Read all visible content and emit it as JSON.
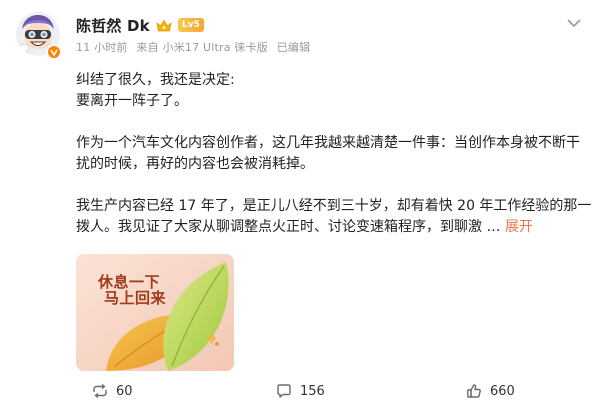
{
  "author": {
    "name": "陈哲然 Dk",
    "level_badge": "Lv5",
    "icons": {
      "avatar": "cartoon-avatar",
      "verified": "orange-vip-badge",
      "member": "crown-icon"
    },
    "brand_color": "#ff8200"
  },
  "meta": {
    "time": "11 小时前",
    "source": "来自 小米17 Ultra 徕卡版",
    "edited": "已编辑"
  },
  "more_icon": "chevron-down-icon",
  "post": {
    "paragraphs": [
      {
        "lines": [
          "纠结了很久，我还是决定:",
          "要离开一阵子了。"
        ]
      },
      {
        "lines": [
          "作为一个汽车文化内容创作者，这几年我越来越清楚一件事：当创作本身被不断干",
          "扰的时候，再好的内容也会被消耗掉。"
        ]
      },
      {
        "lines": [
          "我生产内容已经 17 年了，是正儿八经不到三十岁，却有着快 20 年工作经验的那一",
          "拨人。我见证了大家从聊调整点火正时、讨论变速箱程序，到聊激 …"
        ]
      }
    ],
    "expand_label": "展开",
    "link_color": "#eb7350"
  },
  "image": {
    "line1": "休息一下",
    "line2": "马上回来"
  },
  "actions": {
    "repost": {
      "icon": "repost-icon",
      "count": "60"
    },
    "comment": {
      "icon": "comment-icon",
      "count": "156"
    },
    "like": {
      "icon": "thumbs-up-icon",
      "count": "660"
    }
  }
}
